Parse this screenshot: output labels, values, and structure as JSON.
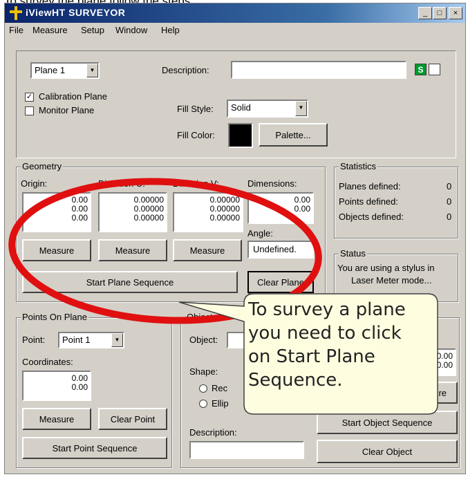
{
  "caption": "To survey the plane follow the steps:",
  "window": {
    "title": "iViewHT SURVEYOR",
    "controls": [
      "_",
      "□",
      "×"
    ]
  },
  "menu": [
    "File",
    "Measure",
    "Setup",
    "Window",
    "Help"
  ],
  "plane": {
    "selected": "Plane 1",
    "description_label": "Description:",
    "description_value": "",
    "s_badge": "S",
    "calibration_label": "Calibration Plane",
    "calibration_checked": "✓",
    "monitor_label": "Monitor Plane",
    "fill_style_label": "Fill Style:",
    "fill_style_value": "Solid",
    "fill_color_label": "Fill Color:",
    "fill_color": "#000000",
    "palette_button": "Palette..."
  },
  "geometry": {
    "title": "Geometry",
    "origin_label": "Origin:",
    "origin": [
      "0.00",
      "0.00",
      "0.00"
    ],
    "dir_u_label": "Direction U:",
    "dir_u": [
      "0.00000",
      "0.00000",
      "0.00000"
    ],
    "dir_v_label": "Direction V:",
    "dir_v": [
      "0.00000",
      "0.00000",
      "0.00000"
    ],
    "dimensions_label": "Dimensions:",
    "dimensions": [
      "0.00",
      "0.00"
    ],
    "angle_label": "Angle:",
    "angle_value": "Undefined.",
    "measure_label": "Measure",
    "start_plane_sequence": "Start Plane Sequence",
    "clear_plane": "Clear Plane"
  },
  "statistics": {
    "title": "Statistics",
    "rows": [
      {
        "label": "Planes defined:",
        "value": "0"
      },
      {
        "label": "Points defined:",
        "value": "0"
      },
      {
        "label": "Objects defined:",
        "value": "0"
      }
    ]
  },
  "status": {
    "title": "Status",
    "text_line1": "You are using a stylus in",
    "text_line2": "Laser Meter mode..."
  },
  "points": {
    "title": "Points On Plane",
    "point_label": "Point:",
    "point_value": "Point 1",
    "coordinates_label": "Coordinates:",
    "coordinates": [
      "0.00",
      "0.00"
    ],
    "measure": "Measure",
    "clear_point": "Clear Point",
    "start_point_sequence": "Start Point Sequence"
  },
  "objects": {
    "title": "Objects O",
    "object_label": "Object:",
    "shape_label": "Shape:",
    "rect_label": "Rec",
    "ellipse_label": "Ellip",
    "description_label": "Description:",
    "values": [
      "0.00",
      "0.00"
    ],
    "measure_partial": "re",
    "start_object_sequence": "Start Object Sequence",
    "clear_object": "Clear Object"
  },
  "callout": {
    "line1": "To survey a plane",
    "line2": "you need to click",
    "line3": "on Start Plane",
    "line4": "Sequence.",
    "oval_color": "#e01010",
    "bubble_color": "#fffde0"
  }
}
